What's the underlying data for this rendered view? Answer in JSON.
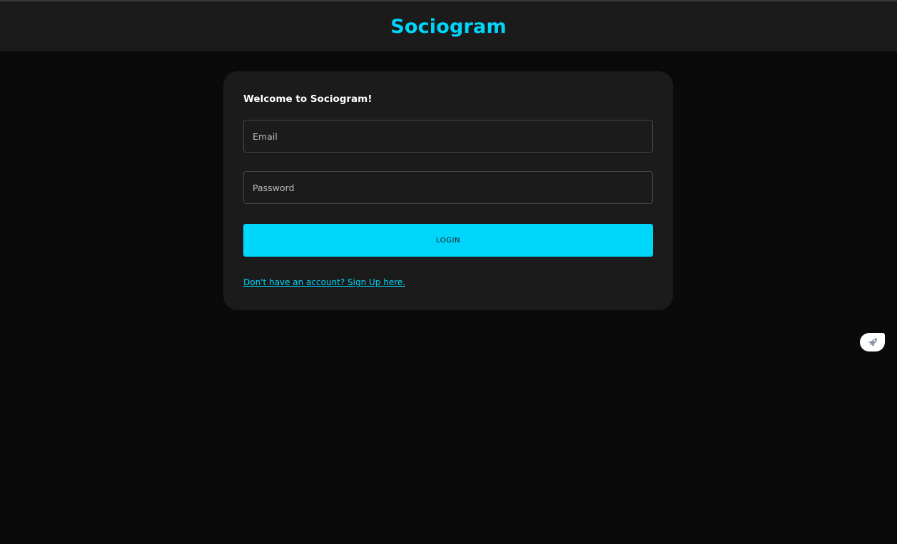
{
  "app": {
    "brand": "Sociogram",
    "accent_color": "#00d5fa"
  },
  "login_card": {
    "title": "Welcome to Sociogram!",
    "email": {
      "placeholder": "Email",
      "value": ""
    },
    "password": {
      "placeholder": "Password",
      "value": ""
    },
    "login_button": "LOGIN",
    "signup_link": "Don't have an account? Sign Up here."
  },
  "floating_widget": {
    "icon": "rocket-icon"
  }
}
